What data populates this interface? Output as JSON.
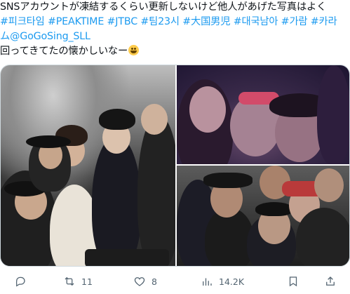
{
  "tweet": {
    "line1": "SNSアカウントが凍結するくらい更新しないけど他人があげた写真はよく",
    "line2_hashtags": [
      "#피크타임",
      "#PEAKTIME",
      "#JTBC",
      "#팀23시",
      "#大国男児",
      "#대국남아",
      "#가람",
      "#카라"
    ],
    "line3_hashtag_tail": "ム",
    "mention": "@GoGoSing_SLL",
    "line4": "回ってきてたの懐かしいなー",
    "emoji": "grinning-face"
  },
  "actions": {
    "reply_count": "",
    "retweet_count": "11",
    "like_count": "8",
    "views_count": "14.2K"
  },
  "colors": {
    "accent": "#1d9bf0",
    "text": "#0f1419",
    "muted": "#536471",
    "border": "#cfd9de"
  },
  "icons": [
    "reply-icon",
    "retweet-icon",
    "like-icon",
    "views-icon",
    "bookmark-icon",
    "share-icon"
  ]
}
